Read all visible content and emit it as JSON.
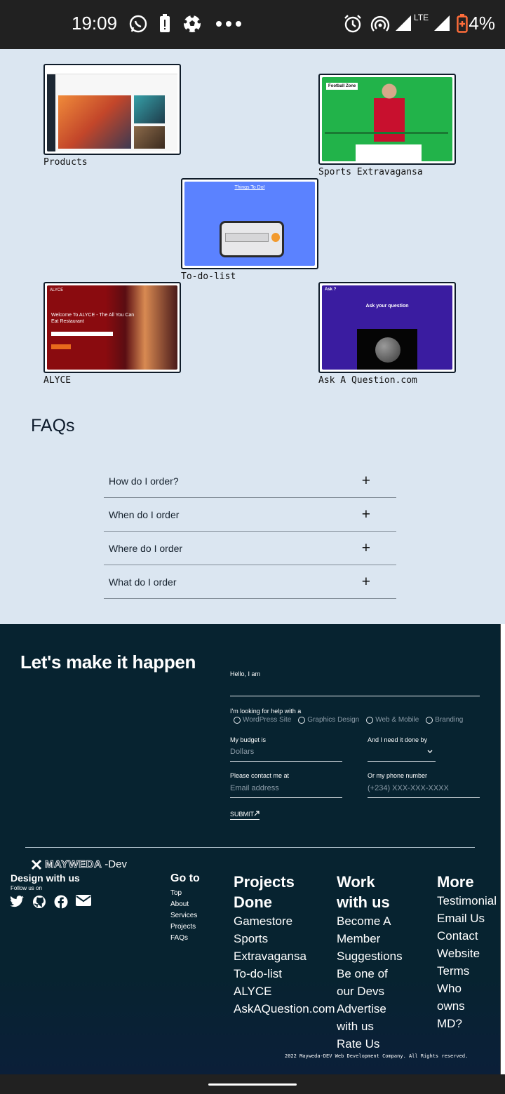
{
  "status_bar": {
    "time": "19:09",
    "network": "LTE",
    "battery": "4%"
  },
  "projects": [
    {
      "label": "Products",
      "thumb_icon": "gamestore-screenshot"
    },
    {
      "label": "Sports Extravagansa",
      "thumb_icon": "football-zone-screenshot"
    },
    {
      "label": "To-do-list",
      "thumb_icon": "todo-screenshot"
    },
    {
      "label": "ALYCE",
      "thumb_icon": "restaurant-screenshot"
    },
    {
      "label": "Ask A Question.com",
      "thumb_icon": "ask-question-screenshot"
    }
  ],
  "thumbnails": {
    "football_title": "Football Zone",
    "todo_title": "Things To Do!",
    "alyce_heading": "Welcome To ALYCE - The All You Can Eat Restaurant",
    "alyce_brand": "ALYCE",
    "ask_title": "Ask your question",
    "ask_brand": "Ask ?"
  },
  "faq": {
    "title": "FAQs",
    "items": [
      {
        "question": "How do I order?",
        "toggle": "+"
      },
      {
        "question": "When do I order",
        "toggle": "+"
      },
      {
        "question": "Where do I order",
        "toggle": "+"
      },
      {
        "question": "What do I order",
        "toggle": "+"
      }
    ]
  },
  "contact": {
    "heading": "Let's make it happen",
    "hello_label": "Hello, I am",
    "help_label": "I'm looking for help with a",
    "options": [
      "WordPress Site",
      "Graphics Design",
      "Web & Mobile",
      "Branding"
    ],
    "budget_label": "My budget is",
    "budget_placeholder": "Dollars",
    "deadline_label": "And I need it done by",
    "email_label": "Please contact me at",
    "email_placeholder": "Email address",
    "phone_label": "Or my phone number",
    "phone_placeholder": "(+234) XXX-XXX-XXXX",
    "submit_label": "SUBMIT",
    "submit_icon": "arrow-up-right-icon"
  },
  "footer": {
    "logo_main": "MAYWEDA",
    "logo_suffix": "-Dev",
    "design_with_us": "Design with us",
    "follow_us": "Follow us on",
    "social_icons": [
      "twitter-icon",
      "github-icon",
      "facebook-icon",
      "email-icon"
    ],
    "goto": {
      "title": "Go to",
      "items": [
        "Top",
        "About",
        "Services",
        "Projects",
        "FAQs"
      ]
    },
    "projects": {
      "title_line1": "Projects",
      "title_line2": "Done",
      "items": [
        "Gamestore",
        "Sports",
        "Extravagansa",
        "To-do-list",
        "ALYCE",
        "AskAQuestion.com"
      ]
    },
    "work": {
      "title_line1": "Work",
      "title_line2": "with us",
      "items": [
        "Become A",
        "Member",
        "Suggestions",
        "Be one of",
        "our Devs",
        "Advertise",
        "with us",
        "Rate Us"
      ]
    },
    "more": {
      "title": "More",
      "items": [
        "Testimonial",
        "Email Us",
        "Contact",
        "Website",
        "Terms",
        "Who",
        "owns",
        "MD?"
      ]
    },
    "copyright": "2022 Mayweda-DEV Web Development Company. All Rights reserved."
  },
  "colors": {
    "page_bg": "#dbe6f1",
    "footer_bg": "#072330",
    "todo_bg": "#5b82ff",
    "football_bg": "#22b34a",
    "alyce_bg": "#8a0b0f",
    "ask_bg": "#3a1ca0"
  }
}
